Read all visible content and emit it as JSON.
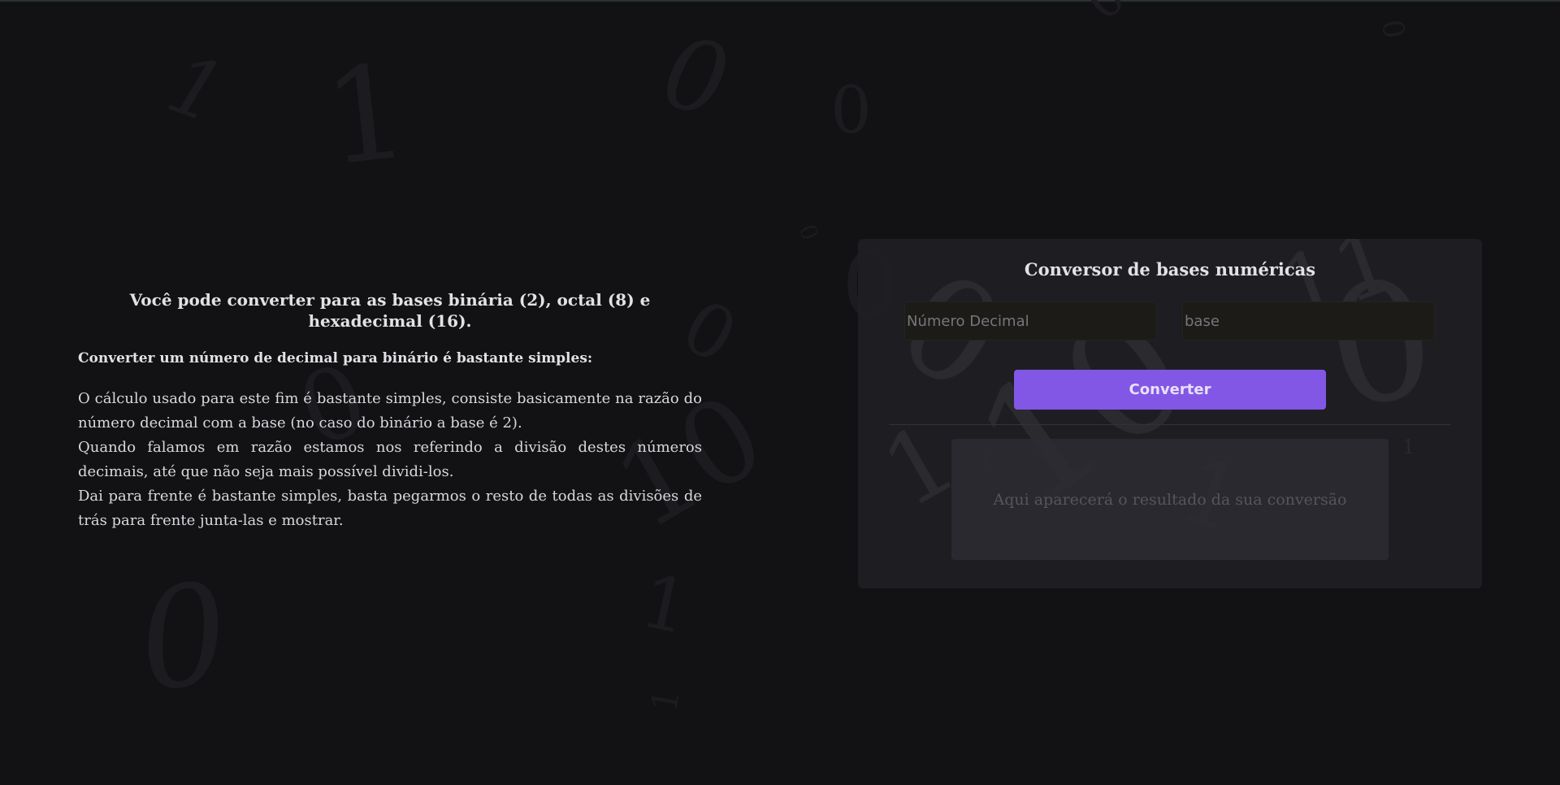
{
  "info": {
    "heading": "Você pode converter para as bases binária (2), octal (8) e hexadecimal (16).",
    "subheading": "Converter um número de decimal para binário é bastante simples:",
    "paragraph": "O cálculo usado para este fim é bastante simples, consiste basicamente na razão do número decimal com a base (no caso do binário a base é 2).\nQuando falamos em razão estamos nos referindo a divisão destes números decimais, até que não seja mais possível dividi-los.\nDai para frente é bastante simples, basta pegarmos o resto de todas as divisões de trás para frente junta-las e mostrar."
  },
  "converter": {
    "title": "Conversor de bases numéricas",
    "decimal_placeholder": "Número Decimal",
    "base_placeholder": "base",
    "button_label": "Converter",
    "result_placeholder": "Aqui aparecerá o resultado da sua conversão"
  },
  "colors": {
    "background": "#121214",
    "card": "#202024",
    "accent": "#8257e5",
    "text": "#e1e1e6"
  }
}
